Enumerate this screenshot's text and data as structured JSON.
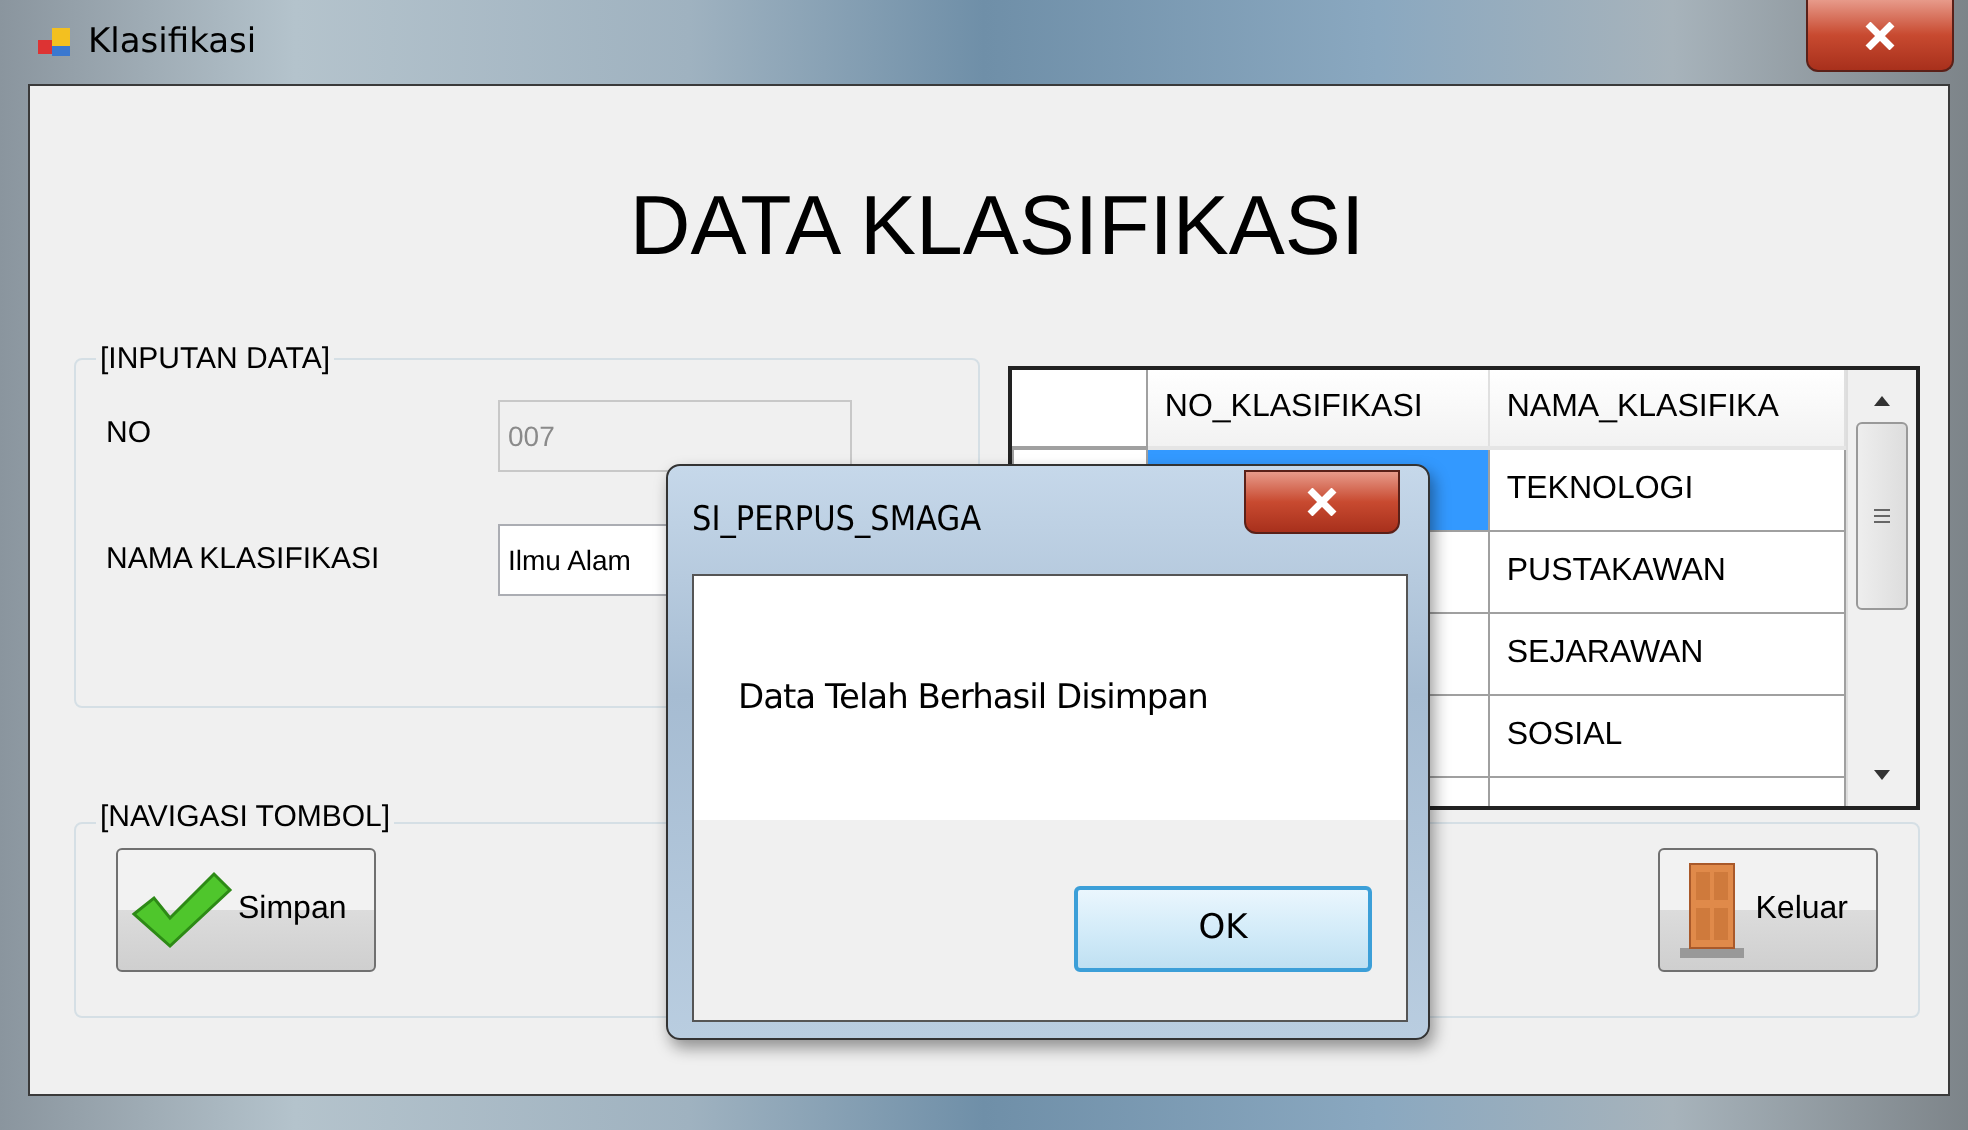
{
  "window": {
    "title": "Klasifikasi"
  },
  "heading": "DATA KLASIFIKASI",
  "input_group": {
    "title": "[INPUTAN DATA]",
    "fields": [
      {
        "label": "NO",
        "value": "007",
        "disabled": true
      },
      {
        "label": "NAMA KLASIFIKASI",
        "value": "Ilmu Alam",
        "disabled": false
      }
    ]
  },
  "table": {
    "columns": [
      "NO_KLASIFIKASI",
      "NAMA_KLASIFIKA"
    ],
    "rows": [
      {
        "nama": "TEKNOLOGI",
        "selected": true
      },
      {
        "nama": "PUSTAKAWAN",
        "selected": false
      },
      {
        "nama": "SEJARAWAN",
        "selected": false
      },
      {
        "nama": "SOSIAL",
        "selected": false
      }
    ]
  },
  "nav_group": {
    "title": "[NAVIGASI TOMBOL]",
    "buttons": [
      {
        "label": "Simpan",
        "kind": "save"
      },
      {
        "label": "Keluar",
        "kind": "exit"
      }
    ]
  },
  "dialog": {
    "title": "SI_PERPUS_SMAGA",
    "message": "Data Telah Berhasil Disimpan",
    "button": "OK"
  }
}
